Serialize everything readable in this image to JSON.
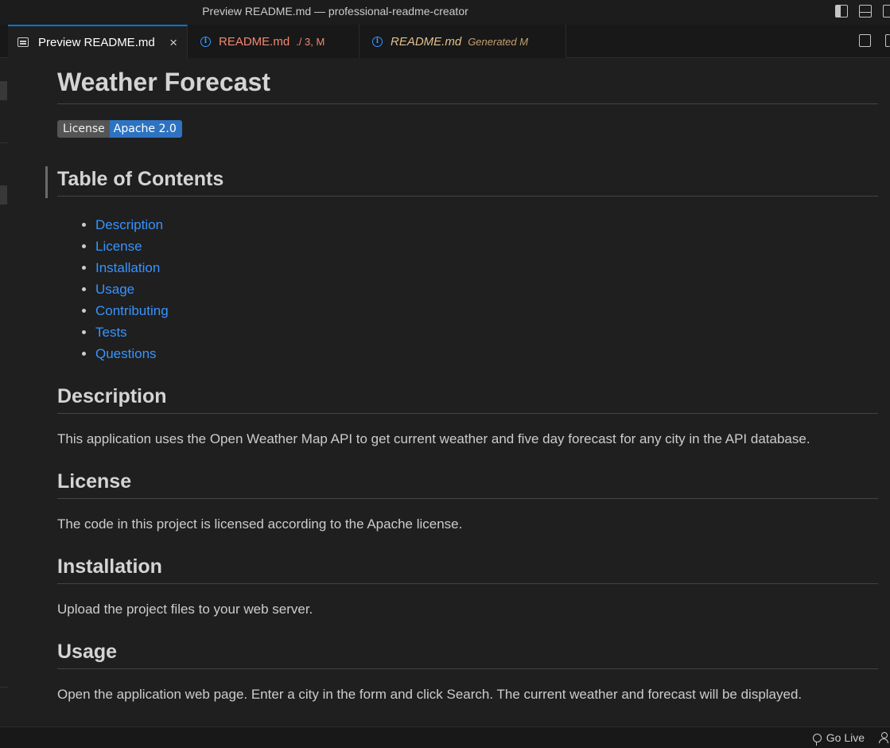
{
  "window": {
    "title": "Preview README.md — professional-readme-creator"
  },
  "tabs": [
    {
      "label": "Preview README.md",
      "icon": "preview-icon",
      "active": true
    },
    {
      "label": "README.md",
      "meta": "./ 3, M",
      "icon": "info-icon"
    },
    {
      "label": "README.md",
      "meta": "Generated  M",
      "icon": "info-icon"
    }
  ],
  "doc": {
    "title": "Weather Forecast",
    "badge": {
      "label": "License",
      "value": "Apache 2.0"
    },
    "toc": {
      "heading": "Table of Contents",
      "items": [
        "Description",
        "License",
        "Installation",
        "Usage",
        "Contributing",
        "Tests",
        "Questions"
      ]
    },
    "sections": [
      {
        "heading": "Description",
        "text": "This application uses the Open Weather Map API to get current weather and five day forecast for any city in the API database."
      },
      {
        "heading": "License",
        "text": "The code in this project is licensed according to the Apache license."
      },
      {
        "heading": "Installation",
        "text": "Upload the project files to your web server."
      },
      {
        "heading": "Usage",
        "text": "Open the application web page. Enter a city in the form and click Search. The current weather and forecast will be displayed."
      }
    ]
  },
  "statusbar": {
    "golive": "Go Live"
  },
  "colors": {
    "accent": "#0078d4",
    "link": "#3794ff",
    "badge_value_bg": "#2d73c2",
    "modified": "#f48771",
    "generated": "#e2c08d"
  }
}
